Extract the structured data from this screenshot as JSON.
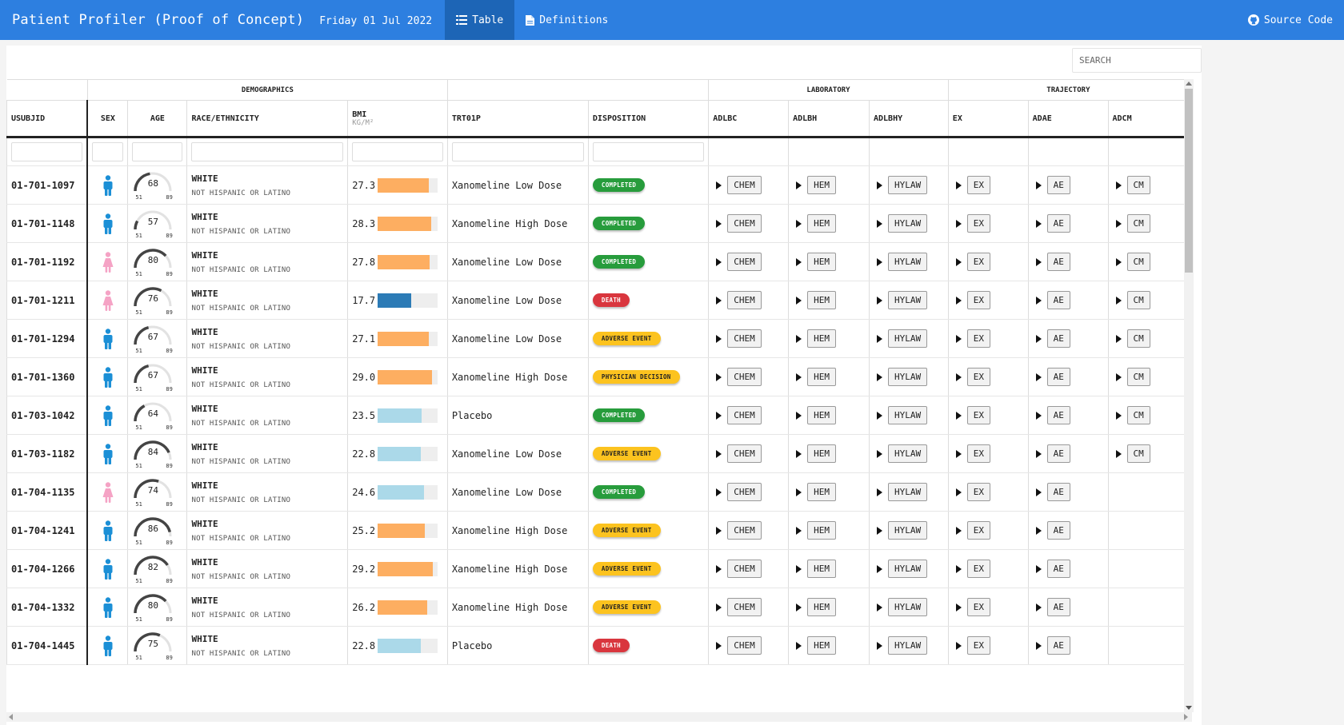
{
  "app": {
    "title": "Patient Profiler (Proof of Concept)",
    "date": "Friday 01 Jul 2022",
    "tabs": [
      {
        "label": "Table",
        "icon": "list-icon",
        "active": true
      },
      {
        "label": "Definitions",
        "icon": "file-icon",
        "active": false
      }
    ],
    "source_code": "Source Code"
  },
  "search": {
    "placeholder": "SEARCH"
  },
  "groups": {
    "demographics": "DEMOGRAPHICS",
    "laboratory": "LABORATORY",
    "trajectory": "TRAJECTORY"
  },
  "columns": {
    "usubjid": "USUBJID",
    "sex": "SEX",
    "age": "AGE",
    "race": "RACE/ETHNICITY",
    "bmi": "BMI",
    "bmi_unit": "KG/M²",
    "trt": "TRT01P",
    "disposition": "DISPOSITION",
    "adlbc": "ADLBC",
    "adlbh": "ADLBH",
    "adlbhy": "ADLBHY",
    "ex": "EX",
    "adae": "ADAE",
    "adcm": "ADCM"
  },
  "age_range": {
    "min": "51",
    "max": "89"
  },
  "colors": {
    "male": "#1b8fd6",
    "female": "#f5a3c5",
    "bmi_high": "#fdae61",
    "bmi_normal": "#abd9e9",
    "bmi_low": "#2c7bb6",
    "completed": "#279c3c",
    "death": "#d9363e",
    "adverse": "#fcc31f"
  },
  "buttons": {
    "chem": "CHEM",
    "hem": "HEM",
    "hylaw": "HYLAW",
    "ex": "EX",
    "ae": "AE",
    "cm": "CM"
  },
  "patients": [
    {
      "id": "01-701-1097",
      "sex": "M",
      "age": "68",
      "race": "WHITE",
      "ethnicity": "NOT HISPANIC OR LATINO",
      "bmi": "27.3",
      "bmi_val": 27.3,
      "trt": "Xanomeline Low Dose",
      "disposition": "COMPLETED",
      "cm": true
    },
    {
      "id": "01-701-1148",
      "sex": "M",
      "age": "57",
      "race": "WHITE",
      "ethnicity": "NOT HISPANIC OR LATINO",
      "bmi": "28.3",
      "bmi_val": 28.3,
      "trt": "Xanomeline High Dose",
      "disposition": "COMPLETED",
      "cm": true
    },
    {
      "id": "01-701-1192",
      "sex": "F",
      "age": "80",
      "race": "WHITE",
      "ethnicity": "NOT HISPANIC OR LATINO",
      "bmi": "27.8",
      "bmi_val": 27.8,
      "trt": "Xanomeline Low Dose",
      "disposition": "COMPLETED",
      "cm": true
    },
    {
      "id": "01-701-1211",
      "sex": "F",
      "age": "76",
      "race": "WHITE",
      "ethnicity": "NOT HISPANIC OR LATINO",
      "bmi": "17.7",
      "bmi_val": 17.7,
      "trt": "Xanomeline Low Dose",
      "disposition": "DEATH",
      "cm": true
    },
    {
      "id": "01-701-1294",
      "sex": "M",
      "age": "67",
      "race": "WHITE",
      "ethnicity": "NOT HISPANIC OR LATINO",
      "bmi": "27.1",
      "bmi_val": 27.1,
      "trt": "Xanomeline Low Dose",
      "disposition": "ADVERSE EVENT",
      "cm": true
    },
    {
      "id": "01-701-1360",
      "sex": "M",
      "age": "67",
      "race": "WHITE",
      "ethnicity": "NOT HISPANIC OR LATINO",
      "bmi": "29.0",
      "bmi_val": 29.0,
      "trt": "Xanomeline High Dose",
      "disposition": "PHYSICIAN DECISION",
      "cm": true
    },
    {
      "id": "01-703-1042",
      "sex": "M",
      "age": "64",
      "race": "WHITE",
      "ethnicity": "NOT HISPANIC OR LATINO",
      "bmi": "23.5",
      "bmi_val": 23.5,
      "trt": "Placebo",
      "disposition": "COMPLETED",
      "cm": true
    },
    {
      "id": "01-703-1182",
      "sex": "M",
      "age": "84",
      "race": "WHITE",
      "ethnicity": "NOT HISPANIC OR LATINO",
      "bmi": "22.8",
      "bmi_val": 22.8,
      "trt": "Xanomeline Low Dose",
      "disposition": "ADVERSE EVENT",
      "cm": true
    },
    {
      "id": "01-704-1135",
      "sex": "F",
      "age": "74",
      "race": "WHITE",
      "ethnicity": "NOT HISPANIC OR LATINO",
      "bmi": "24.6",
      "bmi_val": 24.6,
      "trt": "Xanomeline Low Dose",
      "disposition": "COMPLETED",
      "cm": false
    },
    {
      "id": "01-704-1241",
      "sex": "M",
      "age": "86",
      "race": "WHITE",
      "ethnicity": "NOT HISPANIC OR LATINO",
      "bmi": "25.2",
      "bmi_val": 25.2,
      "trt": "Xanomeline High Dose",
      "disposition": "ADVERSE EVENT",
      "cm": false
    },
    {
      "id": "01-704-1266",
      "sex": "M",
      "age": "82",
      "race": "WHITE",
      "ethnicity": "NOT HISPANIC OR LATINO",
      "bmi": "29.2",
      "bmi_val": 29.2,
      "trt": "Xanomeline High Dose",
      "disposition": "ADVERSE EVENT",
      "cm": false
    },
    {
      "id": "01-704-1332",
      "sex": "M",
      "age": "80",
      "race": "WHITE",
      "ethnicity": "NOT HISPANIC OR LATINO",
      "bmi": "26.2",
      "bmi_val": 26.2,
      "trt": "Xanomeline High Dose",
      "disposition": "ADVERSE EVENT",
      "cm": false
    },
    {
      "id": "01-704-1445",
      "sex": "M",
      "age": "75",
      "race": "WHITE",
      "ethnicity": "NOT HISPANIC OR LATINO",
      "bmi": "22.8",
      "bmi_val": 22.8,
      "trt": "Placebo",
      "disposition": "DEATH",
      "cm": false
    }
  ]
}
